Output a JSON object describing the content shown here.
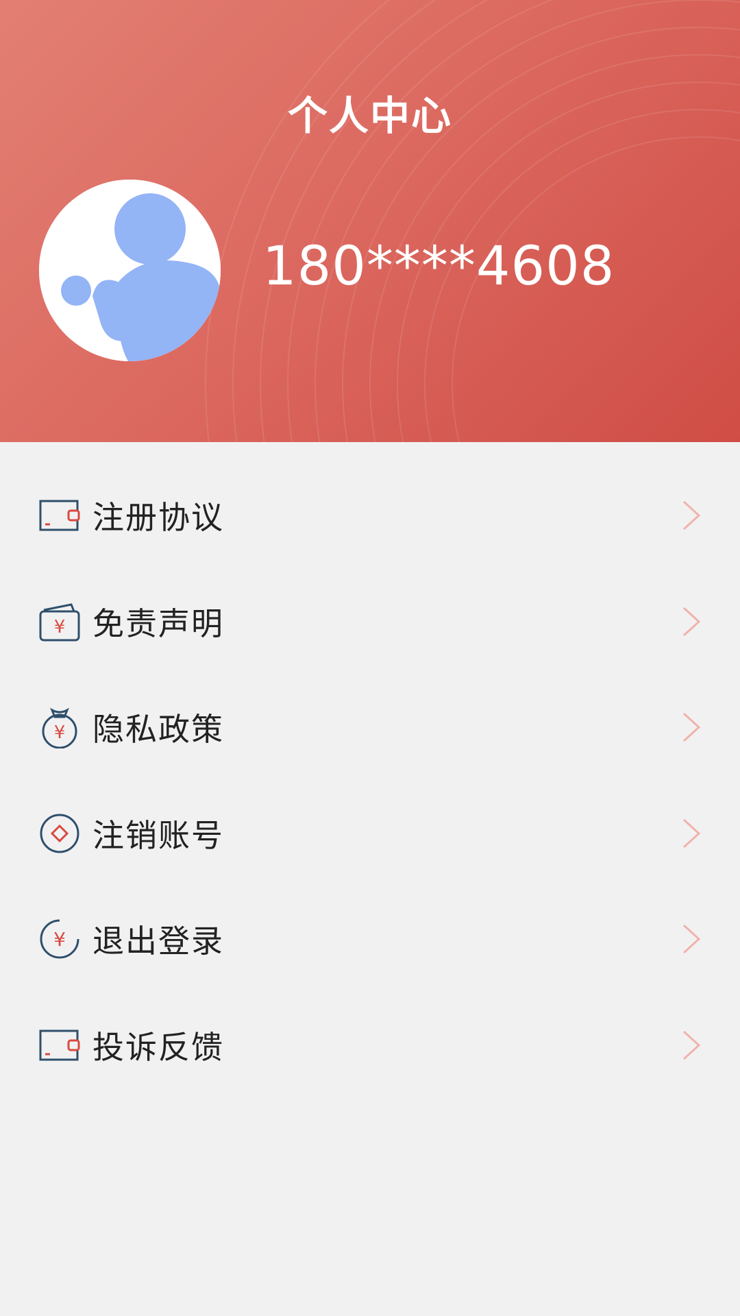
{
  "header": {
    "title": "个人中心",
    "phone": "180****4608"
  },
  "menu": {
    "items": [
      {
        "label": "注册协议",
        "icon": "wallet-card-icon"
      },
      {
        "label": "免责声明",
        "icon": "wallet-yen-icon"
      },
      {
        "label": "隐私政策",
        "icon": "money-bag-icon"
      },
      {
        "label": "注销账号",
        "icon": "diamond-circle-icon"
      },
      {
        "label": "退出登录",
        "icon": "yen-circle-icon"
      },
      {
        "label": "投诉反馈",
        "icon": "wallet-card-icon"
      }
    ]
  },
  "colors": {
    "header_start": "#e27f73",
    "header_end": "#cf4d45",
    "icon_stroke": "#2f4f6b",
    "icon_accent": "#d9493e",
    "chevron": "#f0b3aa",
    "avatar_blue": "#93b4f5"
  }
}
